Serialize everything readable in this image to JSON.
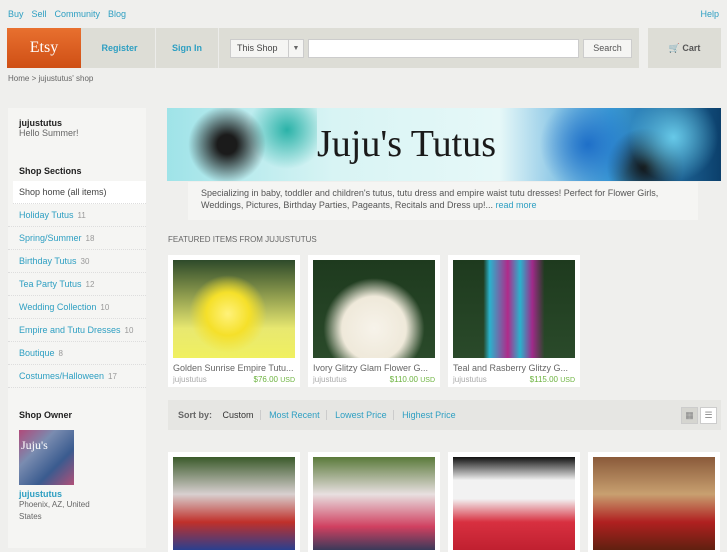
{
  "top_nav": {
    "links": [
      "Buy",
      "Sell",
      "Community",
      "Blog"
    ],
    "help": "Help"
  },
  "header": {
    "logo": "Etsy",
    "register": "Register",
    "sign_in": "Sign In",
    "scope": "This Shop",
    "search_value": "",
    "search_button": "Search",
    "cart": "Cart"
  },
  "breadcrumb": "Home > jujustutus' shop",
  "sidebar": {
    "shop_name": "jujustutus",
    "tagline": "Hello Summer!",
    "sections_title": "Shop Sections",
    "sections": [
      {
        "label": "Shop home (all items)",
        "count": ""
      },
      {
        "label": "Holiday Tutus",
        "count": "11"
      },
      {
        "label": "Spring/Summer",
        "count": "18"
      },
      {
        "label": "Birthday Tutus",
        "count": "30"
      },
      {
        "label": "Tea Party Tutus",
        "count": "12"
      },
      {
        "label": "Wedding Collection",
        "count": "10"
      },
      {
        "label": "Empire and Tutu Dresses",
        "count": "10"
      },
      {
        "label": "Boutique",
        "count": "8"
      },
      {
        "label": "Costumes/Halloween",
        "count": "17"
      }
    ],
    "owner_title": "Shop Owner",
    "owner_name": "jujustutus",
    "owner_location": "Phoenix, AZ, United States",
    "avatar_text": "Juju's Tutus"
  },
  "banner": {
    "title": "Juju's Tutus"
  },
  "description": {
    "text": "Specializing in baby, toddler and children's tutus, tutu dress and empire waist tutu dresses! Perfect for Flower Girls, Weddings, Pictures, Birthday Parties, Pageants, Recitals and Dress up!...",
    "read_more": "read more"
  },
  "featured": {
    "title": "FEATURED ITEMS FROM JUJUSTUTUS",
    "items": [
      {
        "title": "Golden Sunrise Empire Tutu...",
        "shop": "jujustutus",
        "price": "$76.00",
        "currency": "USD"
      },
      {
        "title": "Ivory Glitzy Glam Flower G...",
        "shop": "jujustutus",
        "price": "$110.00",
        "currency": "USD"
      },
      {
        "title": "Teal and Rasberry Glitzy G...",
        "shop": "jujustutus",
        "price": "$115.00",
        "currency": "USD"
      }
    ]
  },
  "sort": {
    "label": "Sort by:",
    "options": [
      "Custom",
      "Most Recent",
      "Lowest Price",
      "Highest Price"
    ]
  }
}
